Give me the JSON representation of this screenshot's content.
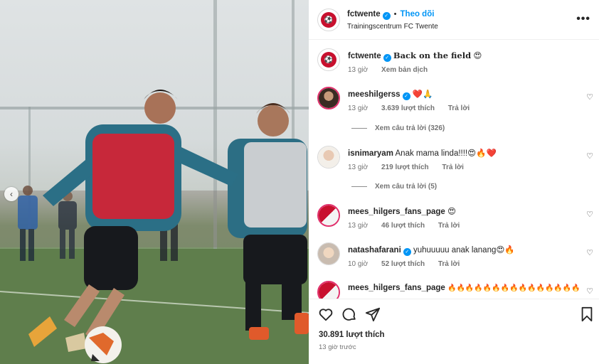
{
  "header": {
    "username": "fctwente",
    "follow_label": "Theo dõi",
    "separator": "•",
    "location": "Trainingscentrum FC Twente",
    "more": "•••"
  },
  "caption": {
    "username": "fctwente",
    "text": "Back on the field",
    "emoji": "😍",
    "time": "13 giờ",
    "translate_label": "Xem bản dịch"
  },
  "comments": [
    {
      "username": "meeshilgerss",
      "verified": true,
      "text": "",
      "emoji": "❤️🙏",
      "time": "13 giờ",
      "likes": "3.639 lượt thích",
      "reply_label": "Trả lời",
      "view_replies": "Xem câu trả lời (326)"
    },
    {
      "username": "isnimaryam",
      "verified": false,
      "text": "Anak mama linda!!!!",
      "emoji": "😍🔥❤️",
      "time": "13 giờ",
      "likes": "219 lượt thích",
      "reply_label": "Trả lời",
      "view_replies": "Xem câu trả lời (5)"
    },
    {
      "username": "mees_hilgers_fans_page",
      "verified": false,
      "text": "",
      "emoji": "😍",
      "time": "13 giờ",
      "likes": "46 lượt thích",
      "reply_label": "Trả lời"
    },
    {
      "username": "natashafarani",
      "verified": true,
      "text": "yuhuuuuu anak lanang",
      "emoji": "😍🔥",
      "time": "10 giờ",
      "likes": "52 lượt thích",
      "reply_label": "Trả lời"
    },
    {
      "username": "mees_hilgers_fans_page",
      "verified": false,
      "text": "",
      "emoji": "🔥🔥🔥🔥🔥🔥🔥🔥🔥🔥🔥🔥🔥🔥🔥"
    }
  ],
  "footer": {
    "likes": "30.891 lượt thích",
    "posted": "13 giờ trước"
  },
  "icons": {
    "heart": "heart-icon",
    "comment": "comment-icon",
    "share": "share-icon",
    "save": "bookmark-icon"
  },
  "colors": {
    "accent": "#0095f6",
    "club_red": "#c8102e"
  }
}
